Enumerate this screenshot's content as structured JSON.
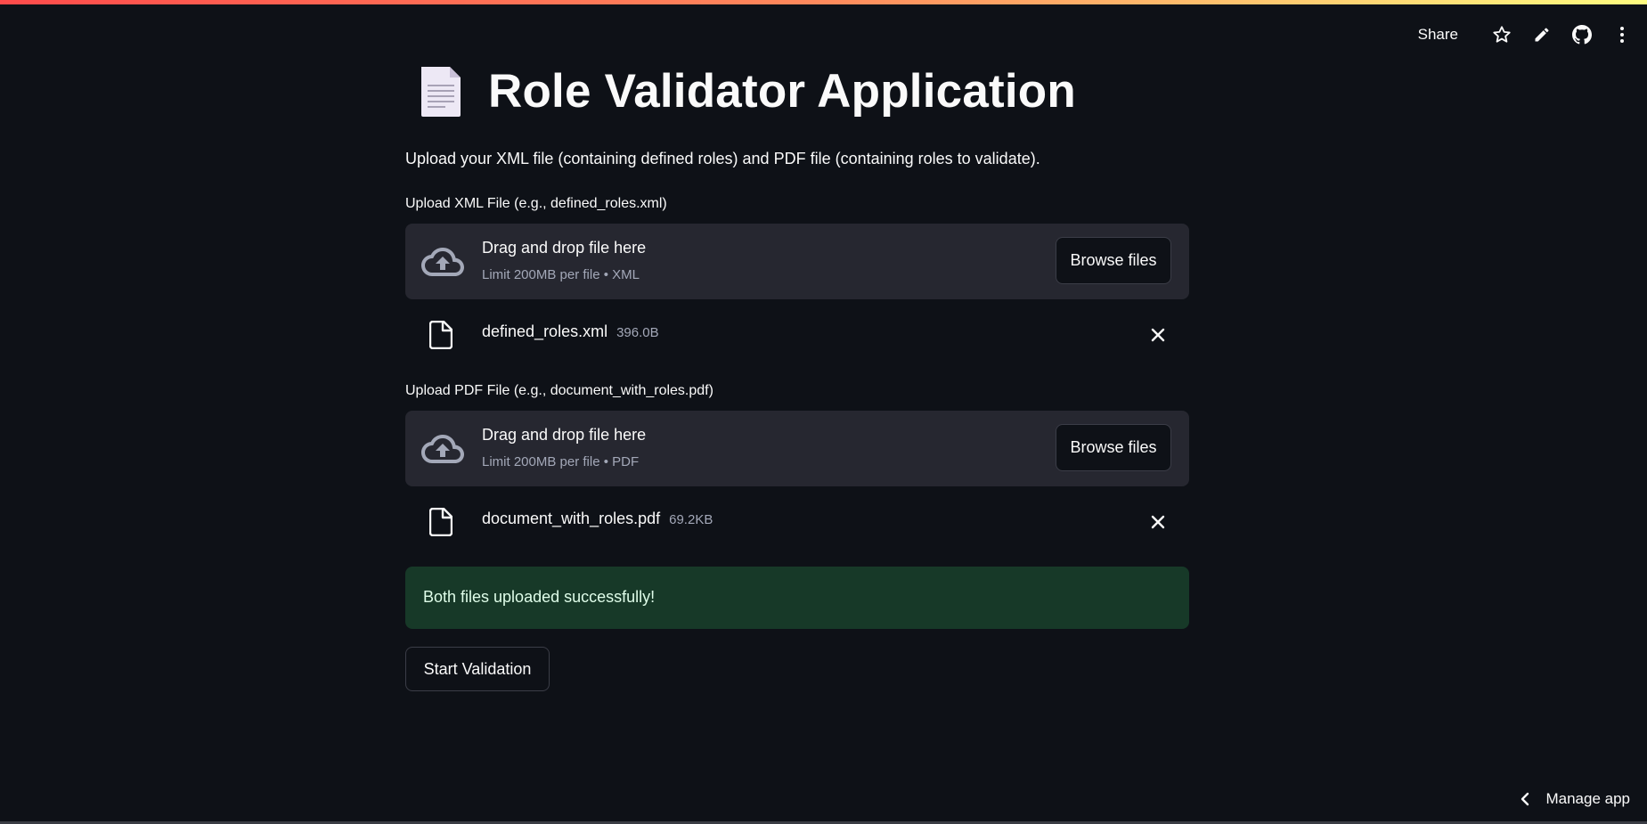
{
  "header": {
    "share_label": "Share",
    "icons": [
      "star-icon",
      "pencil-icon",
      "github-icon",
      "more-vertical-icon"
    ]
  },
  "page": {
    "title": "Role Validator Application",
    "title_icon": "page-facing-up-icon",
    "intro": "Upload your XML file (containing defined roles) and PDF file (containing roles to validate)."
  },
  "xml_uploader": {
    "label": "Upload XML File (e.g., defined_roles.xml)",
    "drop_text": "Drag and drop file here",
    "limit_text": "Limit 200MB per file • XML",
    "browse_label": "Browse files",
    "file": {
      "name": "defined_roles.xml",
      "size": "396.0B"
    }
  },
  "pdf_uploader": {
    "label": "Upload PDF File (e.g., document_with_roles.pdf)",
    "drop_text": "Drag and drop file here",
    "limit_text": "Limit 200MB per file • PDF",
    "browse_label": "Browse files",
    "file": {
      "name": "document_with_roles.pdf",
      "size": "69.2KB"
    }
  },
  "success_message": "Both files uploaded successfully!",
  "start_button_label": "Start Validation",
  "footer": {
    "manage_app_label": "Manage app"
  },
  "colors": {
    "background": "#0e1117",
    "dropzone": "#262730",
    "success_bg": "#173928",
    "accent": "#ff4b4b"
  }
}
